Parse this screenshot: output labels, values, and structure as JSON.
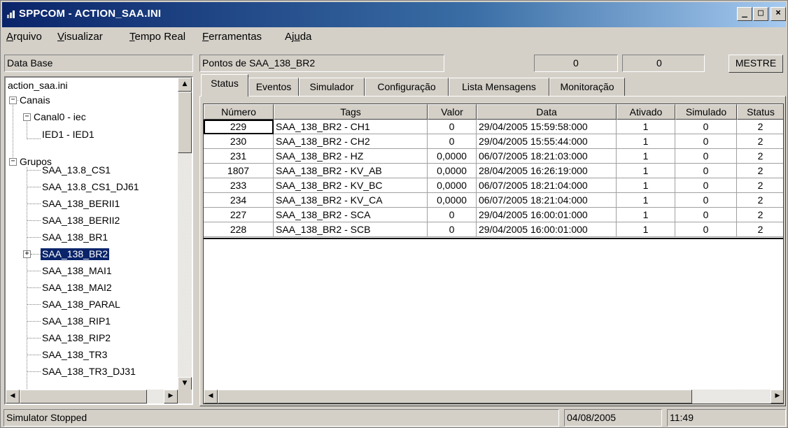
{
  "window": {
    "title": "SPPCOM - ACTION_SAA.INI",
    "min_label": "_",
    "max_label": "□",
    "close_label": "×"
  },
  "menu": {
    "items": [
      {
        "pre": "",
        "u": "A",
        "post": "rquivo"
      },
      {
        "pre": "",
        "u": "V",
        "post": "isualizar"
      },
      {
        "pre": "",
        "u": "T",
        "post": "empo Real"
      },
      {
        "pre": "",
        "u": "F",
        "post": "erramentas"
      },
      {
        "pre": "Aj",
        "u": "u",
        "post": "da"
      }
    ]
  },
  "header": {
    "database_label": "Data Base",
    "points_label": "Pontos de SAA_138_BR2",
    "counter1": "0",
    "counter2": "0",
    "mode_button": "MESTRE"
  },
  "tree": {
    "root": "action_saa.ini",
    "channels": "Canais",
    "channel0": "Canal0 - iec",
    "ied1": "IED1 - IED1",
    "groups": "Grupos",
    "group_items": [
      "SAA_13.8_CS1",
      "SAA_13.8_CS1_DJ61",
      "SAA_138_BERII1",
      "SAA_138_BERII2",
      "SAA_138_BR1",
      "SAA_138_BR2",
      "SAA_138_MAI1",
      "SAA_138_MAI2",
      "SAA_138_PARAL",
      "SAA_138_RIP1",
      "SAA_138_RIP2",
      "SAA_138_TR3",
      "SAA_138_TR3_DJ31"
    ],
    "selected": "SAA_138_BR2"
  },
  "tabs": [
    "Status",
    "Eventos",
    "Simulador",
    "Configuração",
    "Lista Mensagens",
    "Monitoração"
  ],
  "table": {
    "columns": [
      "Número",
      "Tags",
      "Valor",
      "Data",
      "Ativado",
      "Simulado",
      "Status"
    ],
    "rows": [
      [
        "229",
        "SAA_138_BR2 - CH1",
        "0",
        "29/04/2005 15:59:58:000",
        "1",
        "0",
        "2"
      ],
      [
        "230",
        "SAA_138_BR2 - CH2",
        "0",
        "29/04/2005 15:55:44:000",
        "1",
        "0",
        "2"
      ],
      [
        "231",
        "SAA_138_BR2 - HZ",
        "0,0000",
        "06/07/2005 18:21:03:000",
        "1",
        "0",
        "2"
      ],
      [
        "1807",
        "SAA_138_BR2 - KV_AB",
        "0,0000",
        "28/04/2005 16:26:19:000",
        "1",
        "0",
        "2"
      ],
      [
        "233",
        "SAA_138_BR2 - KV_BC",
        "0,0000",
        "06/07/2005 18:21:04:000",
        "1",
        "0",
        "2"
      ],
      [
        "234",
        "SAA_138_BR2 - KV_CA",
        "0,0000",
        "06/07/2005 18:21:04:000",
        "1",
        "0",
        "2"
      ],
      [
        "227",
        "SAA_138_BR2 - SCA",
        "0",
        "29/04/2005 16:00:01:000",
        "1",
        "0",
        "2"
      ],
      [
        "228",
        "SAA_138_BR2 - SCB",
        "0",
        "29/04/2005 16:00:01:000",
        "1",
        "0",
        "2"
      ]
    ]
  },
  "status_bar": {
    "message": "Simulator Stopped",
    "date": "04/08/2005",
    "time": "11:49"
  },
  "colors": {
    "titlebar_start": "#0a246a",
    "titlebar_end": "#a6caf0",
    "selection": "#0a246a",
    "face": "#d4d0c8"
  }
}
